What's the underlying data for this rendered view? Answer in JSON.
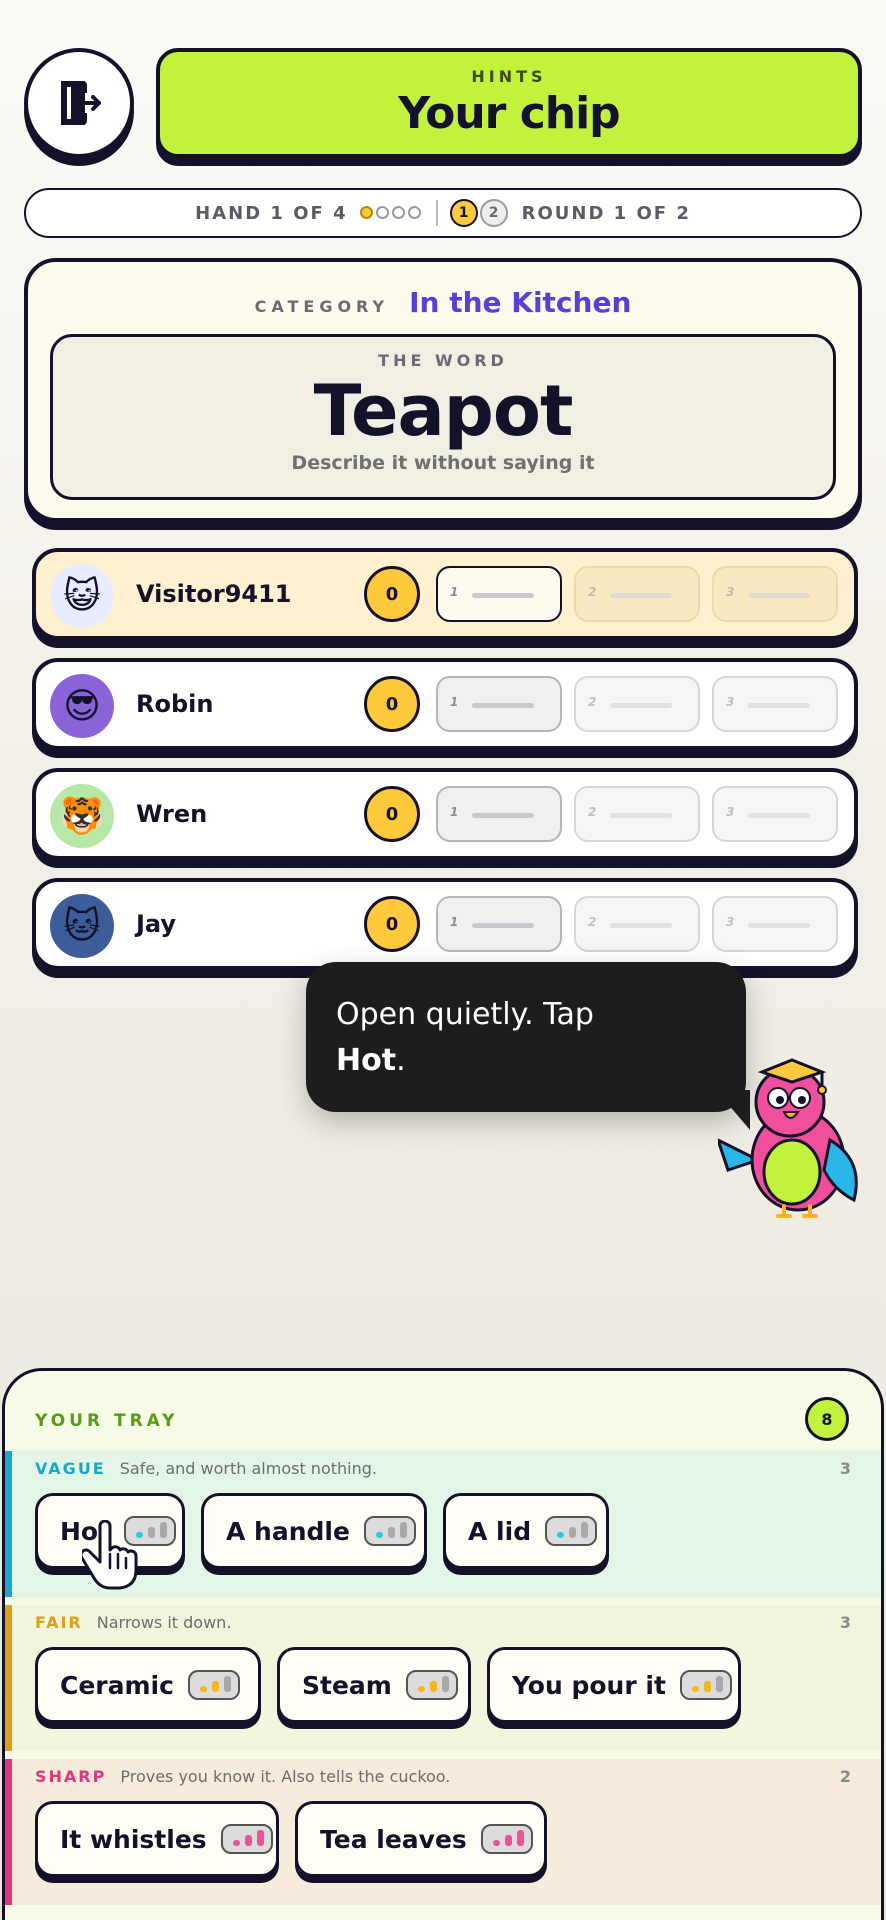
{
  "header": {
    "exit_icon": "exit-door-icon",
    "hints_label": "HINTS",
    "hints_title": "Your chip"
  },
  "progress": {
    "hand_text": "HAND 1 OF 4",
    "hand_dots": [
      true,
      false,
      false,
      false
    ],
    "rounds": [
      "1",
      "2"
    ],
    "round_text": "ROUND 1 OF 2"
  },
  "category": {
    "label": "CATEGORY",
    "value": "In the Kitchen",
    "word_label": "THE WORD",
    "word": "Teapot",
    "instruction": "Describe it without saying it"
  },
  "players": [
    {
      "name": "Visitor9411",
      "score": "0",
      "avatar": "cat-smile-icon",
      "slots": [
        "1",
        "2",
        "3"
      ],
      "me": true
    },
    {
      "name": "Robin",
      "score": "0",
      "avatar": "cat-sunglasses-icon",
      "slots": [
        "1",
        "2",
        "3"
      ],
      "me": false
    },
    {
      "name": "Wren",
      "score": "0",
      "avatar": "tiger-icon",
      "slots": [
        "1",
        "2",
        "3"
      ],
      "me": false
    },
    {
      "name": "Jay",
      "score": "0",
      "avatar": "orange-cat-icon",
      "slots": [
        "1",
        "2",
        "3"
      ],
      "me": false
    }
  ],
  "tooltip": {
    "text_before": "Open quietly. Tap",
    "highlight": "Hot",
    "text_after": "."
  },
  "tray": {
    "title": "YOUR TRAY",
    "count": "8",
    "tiers": [
      {
        "name": "VAGUE",
        "desc": "Safe, and worth almost nothing.",
        "count": "3",
        "color": "#1aa7c9",
        "bg": "#e3f5e6",
        "chips": [
          "Hot",
          "A handle",
          "A lid"
        ]
      },
      {
        "name": "FAIR",
        "desc": "Narrows it down.",
        "count": "3",
        "color": "#d9a21a",
        "bg": "#f2f5dc",
        "chips": [
          "Ceramic",
          "Steam",
          "You pour it"
        ]
      },
      {
        "name": "SHARP",
        "desc": "Proves you know it. Also tells the cuckoo.",
        "count": "2",
        "color": "#e0357f",
        "bg": "#f5ecdc",
        "chips": [
          "It whistles",
          "Tea leaves"
        ]
      }
    ]
  },
  "colors": {
    "accent": "#c3f23c",
    "category": "#5541d9",
    "score": "#ffc93c",
    "ink": "#14122a"
  }
}
